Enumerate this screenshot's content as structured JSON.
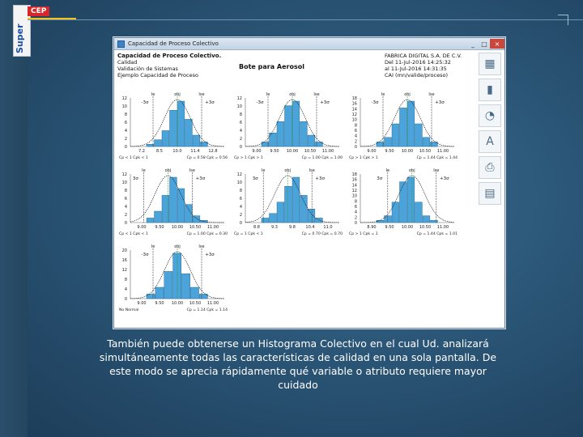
{
  "brand": {
    "vertical": "Super",
    "tag": "CEP"
  },
  "window": {
    "title": "Capacidad de Proceso Colectivo",
    "controls": [
      "_",
      "□",
      "×"
    ]
  },
  "info": {
    "heading": "Capacidad de Proceso Colectivo.",
    "lines": [
      "Calidad",
      "Validación de Sistemas",
      "Ejemplo Capacidad de Proceso"
    ],
    "product": "Bote para Aerosol",
    "company": "FABRICA DIGITAL S.A. DE C.V.",
    "date_from": "Del  11-Jul-2016  14:25:32",
    "date_to": "al  11-Jul-2016  14:31:35",
    "path": "CAI (mn/valide/proceso)"
  },
  "tools": [
    "chart-histogram-icon",
    "chart-bar-icon",
    "chart-pie-icon",
    "font-icon",
    "print-icon",
    "report-icon"
  ],
  "charts": [
    {
      "top": [
        "Ie",
        "obj",
        "Ise"
      ],
      "sl": "-3σ",
      "sr": "+3σ",
      "yt": [
        "12",
        "10",
        "8",
        "6",
        "4",
        "2",
        "0"
      ],
      "xt": [
        "7.2",
        "8.5",
        "10.0",
        "11.4",
        "12.8"
      ],
      "bars": [
        0.05,
        0.15,
        0.35,
        0.8,
        1.0,
        0.6,
        0.25,
        0.1
      ],
      "foot": "Cp < 1  Cpk < 1",
      "stat": "Cp = 0.58  Cpk = 0.56",
      "shift": 0
    },
    {
      "top": [
        "Ie",
        "obj",
        "Ise"
      ],
      "sl": "-3σ",
      "sr": "+3σ",
      "yt": [
        "12",
        "10",
        "8",
        "6",
        "4",
        "2",
        "0"
      ],
      "xt": [
        "9.00",
        "9.50",
        "10.00",
        "10.50",
        "11.00"
      ],
      "bars": [
        0.1,
        0.3,
        0.55,
        0.9,
        1.0,
        0.55,
        0.25,
        0.1
      ],
      "foot": "Cp > 1  Cpk > 1",
      "stat": "Cp = 1.00  Cpk = 1.00",
      "shift": 0
    },
    {
      "top": [
        "Ie",
        "obj",
        "Ise"
      ],
      "sl": "-3σ",
      "sr": "+3σ",
      "yt": [
        "18",
        "16",
        "14",
        "12",
        "10",
        "8",
        "6",
        "4",
        "2",
        "0"
      ],
      "xt": [
        "9.00",
        "9.50",
        "10.00",
        "10.50",
        "11.00"
      ],
      "bars": [
        0.1,
        0.2,
        0.5,
        0.85,
        1.0,
        0.5,
        0.2,
        0.1
      ],
      "foot": "Cp > 1  Cpk > 1",
      "stat": "Cp = 1.44  Cpk = 1.44",
      "shift": 0
    },
    {
      "top": [
        "Ie",
        "obj",
        "Ise"
      ],
      "sl": "3σ",
      "sr": "+3σ",
      "yt": [
        "12",
        "10",
        "8",
        "6",
        "4",
        "2",
        "0"
      ],
      "xt": [
        "9.00",
        "9.50",
        "10.00",
        "10.50",
        "11.00"
      ],
      "bars": [
        0.1,
        0.25,
        0.6,
        1.0,
        0.75,
        0.4,
        0.15,
        0.05
      ],
      "foot": "Cp < 1  Cpk < 1",
      "stat": "Cp = 1.00  Cpk = 0.30",
      "shift": -0.1
    },
    {
      "top": [
        "Ie",
        "obj",
        "Ise"
      ],
      "sl": "3σ",
      "sr": "+3σ",
      "yt": [
        "12",
        "10",
        "8",
        "6",
        "4",
        "2",
        "0"
      ],
      "xt": [
        "8.8",
        "9.3",
        "9.8",
        "10.4",
        "11.0"
      ],
      "bars": [
        0.1,
        0.2,
        0.45,
        0.8,
        1.0,
        0.6,
        0.3,
        0.1
      ],
      "foot": "Cp = 1  Cpk < 1",
      "stat": "Cp = 0.70  Cpk = 0.70",
      "shift": -0.05
    },
    {
      "top": [
        "Ie",
        "obj",
        "Ise"
      ],
      "sl": "3σ",
      "sr": "+3σ",
      "yt": [
        "18",
        "16",
        "14",
        "12",
        "10",
        "8",
        "6",
        "4",
        "2",
        "0"
      ],
      "xt": [
        "8.90",
        "9.50",
        "10.00",
        "10.50",
        "11.00"
      ],
      "bars": [
        0.05,
        0.15,
        0.45,
        0.9,
        1.0,
        0.45,
        0.15,
        0.05
      ],
      "foot": "Cp > 1  Cpk = 1",
      "stat": "Cp = 1.44  Cpk = 1.01",
      "shift": 0.05
    },
    {
      "top": [
        "Ie",
        "obj",
        "Ise"
      ],
      "sl": "-3σ",
      "sr": "+3σ",
      "yt": [
        "20",
        "16",
        "12",
        "8",
        "4",
        "0"
      ],
      "xt": [
        "9.00",
        "9.50",
        "10.00",
        "10.50",
        "11.00"
      ],
      "bars": [
        0.1,
        0.25,
        0.6,
        1.0,
        0.55,
        0.25,
        0.1
      ],
      "foot": "No Normal",
      "stat": "Cp = 1.14  Cpk = 1.14",
      "shift": 0
    }
  ],
  "caption": "También puede obtenerse un Histograma Colectivo en el cual Ud. analizará simultáneamente todas las características de calidad en una sola pantalla. De este modo se aprecia rápidamente qué variable o atributo requiere mayor cuidado"
}
